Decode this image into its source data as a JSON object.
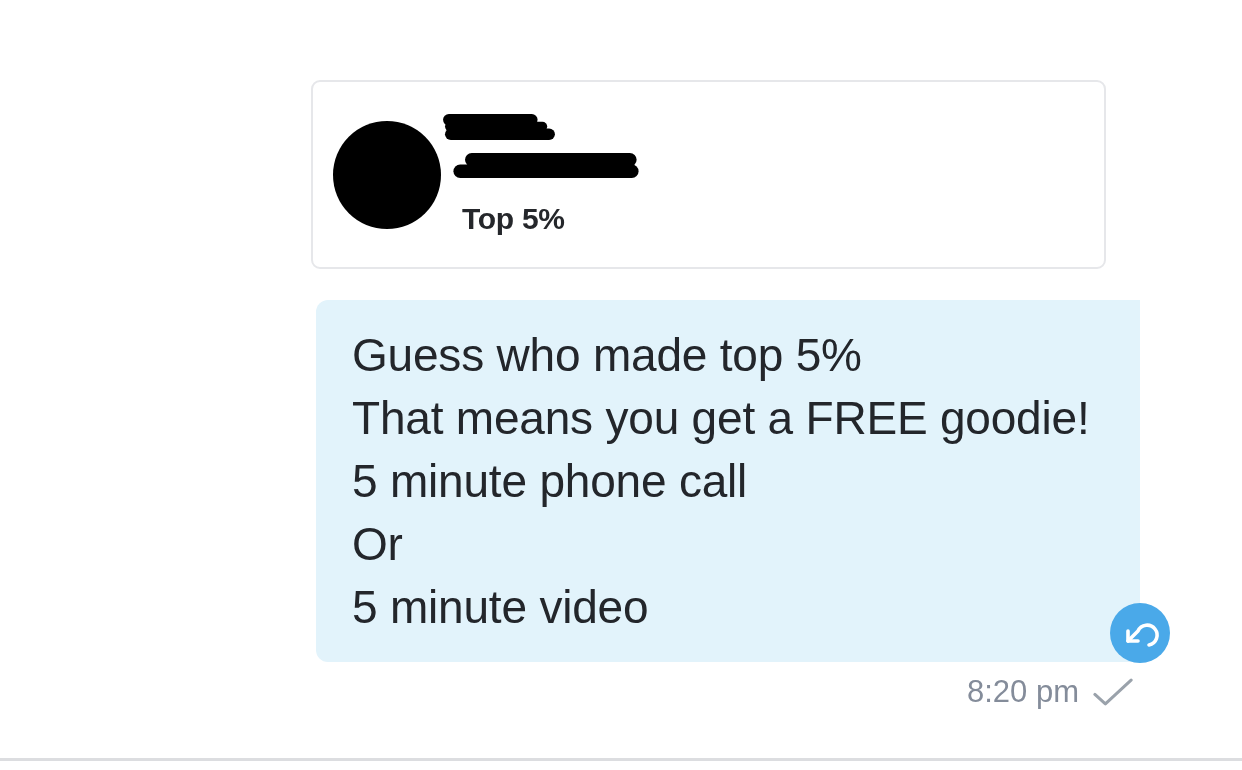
{
  "profile_card": {
    "name_redacted": true,
    "handle_redacted": true,
    "badge": "Top 5%"
  },
  "message": {
    "lines": [
      "Guess who made top 5%",
      "That means you get a FREE goodie!",
      "5 minute phone call",
      "Or",
      "5 minute video"
    ],
    "time": "8:20 pm",
    "sent": true
  }
}
